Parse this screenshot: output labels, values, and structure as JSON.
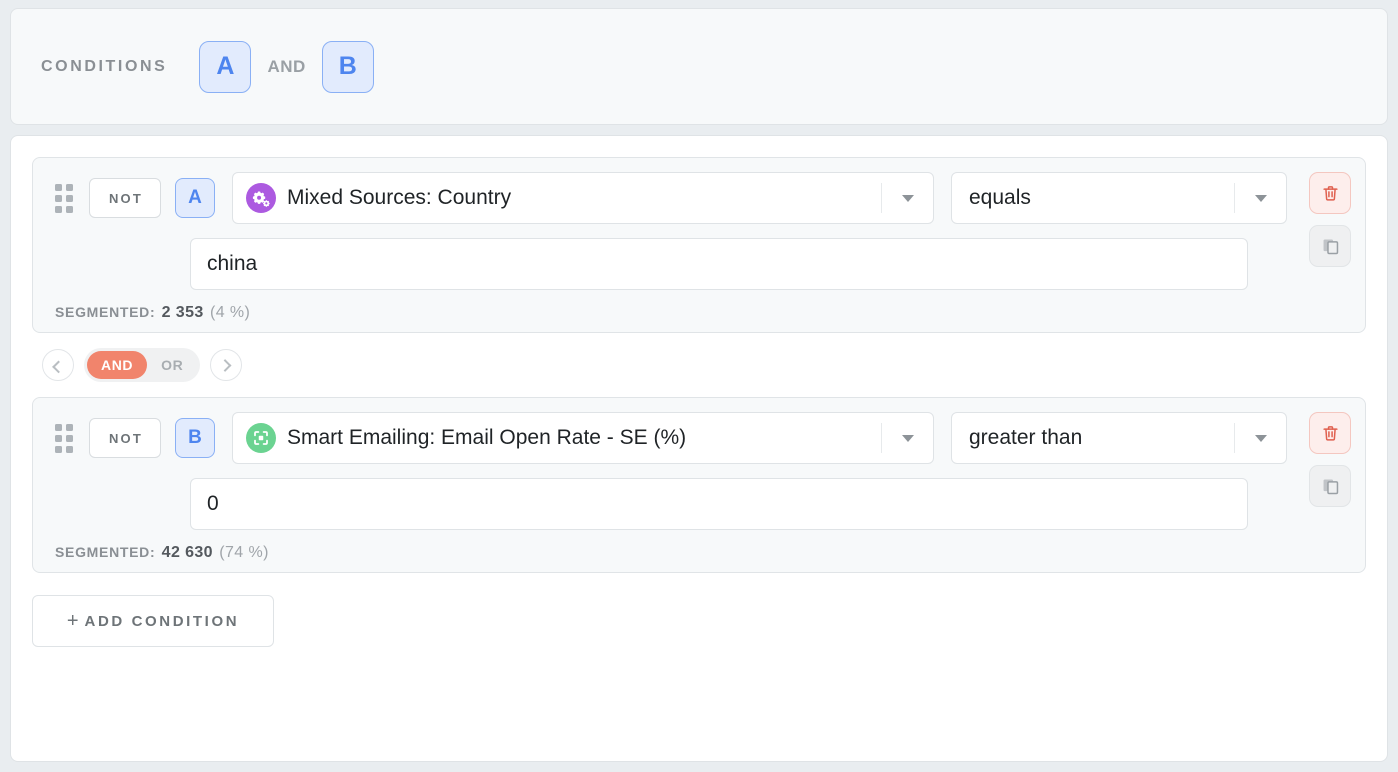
{
  "header": {
    "title": "CONDITIONS",
    "chips": [
      {
        "label": "A"
      },
      {
        "label": "B"
      }
    ],
    "joiner": "AND"
  },
  "colors": {
    "accent_blue": "#4e85ef",
    "chip_bg": "#e2ebfd",
    "active_joiner": "#f1846c",
    "delete_red": "#e0604f",
    "source_purple": "#ac5ae0",
    "source_green": "#6bd391",
    "page_bg": "#e9edf0",
    "card_bg": "#ffffff",
    "block_bg": "#f7f9fa"
  },
  "conditions": [
    {
      "not_label": "NOT",
      "letter": "A",
      "source_icon": "gears-icon",
      "source_icon_color": "#ac5ae0",
      "field": "Mixed Sources: Country",
      "operator": "equals",
      "value": "china",
      "value_placeholder": "",
      "segmented": {
        "label": "SEGMENTED:",
        "count": "2 353",
        "percent": "(4 %)"
      },
      "delete_label": "trash-icon",
      "copy_label": "copy-icon"
    },
    {
      "not_label": "NOT",
      "letter": "B",
      "source_icon": "frame-icon",
      "source_icon_color": "#6bd391",
      "field": "Smart Emailing: Email Open Rate - SE (%)",
      "operator": "greater than",
      "value": "0",
      "value_placeholder": "",
      "segmented": {
        "label": "SEGMENTED:",
        "count": "42 630",
        "percent": "(74 %)"
      },
      "delete_label": "trash-icon",
      "copy_label": "copy-icon"
    }
  ],
  "joiner_control": {
    "prev": "chevron-left-icon",
    "next": "chevron-right-icon",
    "and_label": "AND",
    "or_label": "OR",
    "selected": "AND"
  },
  "add_condition": {
    "plus": "+",
    "label": "ADD CONDITION"
  }
}
